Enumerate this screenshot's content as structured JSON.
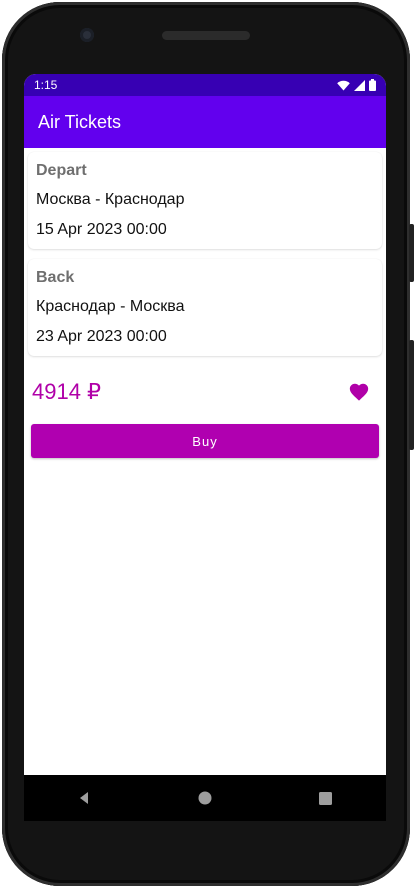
{
  "status_bar": {
    "time": "1:15",
    "icons": [
      "wifi-icon",
      "signal-icon",
      "battery-icon"
    ]
  },
  "app_bar": {
    "title": "Air Tickets"
  },
  "depart": {
    "label": "Depart",
    "route": "Москва - Краснодар",
    "datetime": "15 Apr 2023 00:00"
  },
  "back": {
    "label": "Back",
    "route": "Краснодар - Москва",
    "datetime": "23 Apr 2023 00:00"
  },
  "price": {
    "text": "4914 ₽"
  },
  "favorite": {
    "icon": "heart-icon",
    "color": "#b000a8",
    "active": true
  },
  "buy_button": {
    "label": "Buy"
  },
  "nav": {
    "icons": [
      "back-icon",
      "home-icon",
      "recents-icon"
    ]
  },
  "colors": {
    "status_bar": "#3700b3",
    "app_bar": "#6200ee",
    "accent": "#b000b0"
  }
}
